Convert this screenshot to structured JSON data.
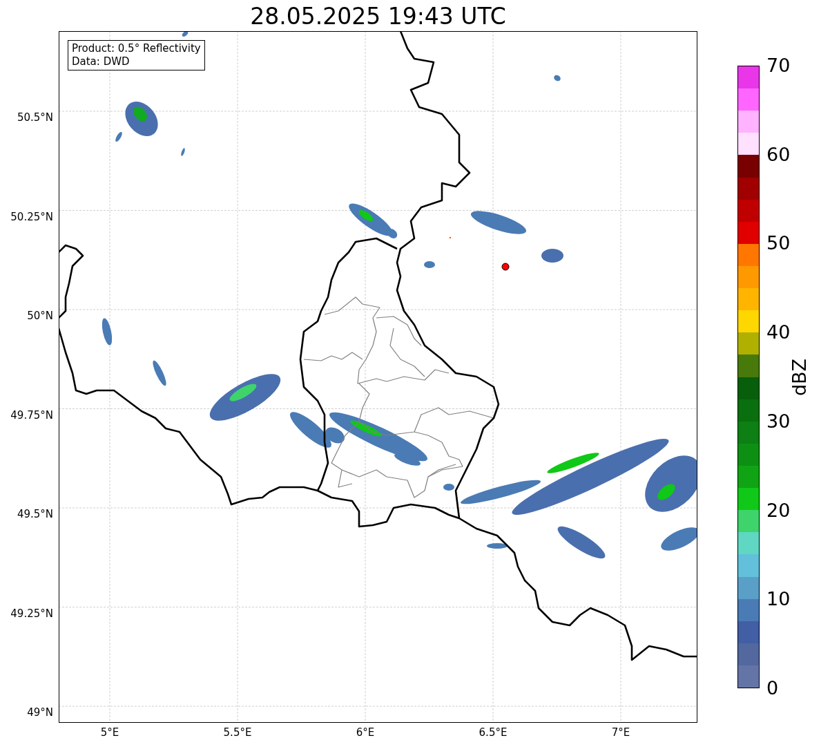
{
  "title": "28.05.2025 19:43 UTC",
  "info_box": {
    "lines": [
      "Product: 0.5° Reflectivity",
      "Data: DWD"
    ]
  },
  "map": {
    "x_ticks": [
      "5°E",
      "5.5°E",
      "6°E",
      "6.5°E",
      "7°E"
    ],
    "y_ticks": [
      "50.5°N",
      "50.25°N",
      "50°N",
      "49.75°N",
      "49.5°N",
      "49.25°N",
      "49°N"
    ]
  },
  "colorbar": {
    "label": "dBZ",
    "ticks": [
      "70",
      "60",
      "50",
      "40",
      "30",
      "20",
      "10",
      "0"
    ],
    "bands": [
      {
        "color": "#e936e9"
      },
      {
        "color": "#ff66ff"
      },
      {
        "color": "#ffb3ff"
      },
      {
        "color": "#ffe0ff"
      },
      {
        "color": "#780000"
      },
      {
        "color": "#a00000"
      },
      {
        "color": "#c00000"
      },
      {
        "color": "#e00000"
      },
      {
        "color": "#ff7700"
      },
      {
        "color": "#ff9900"
      },
      {
        "color": "#ffb400"
      },
      {
        "color": "#ffd700"
      },
      {
        "color": "#b0b000"
      },
      {
        "color": "#477a0a"
      },
      {
        "color": "#075e0b"
      },
      {
        "color": "#0a6f0f"
      },
      {
        "color": "#0d7f14"
      },
      {
        "color": "#0d8f14"
      },
      {
        "color": "#10a414"
      },
      {
        "color": "#10c817"
      },
      {
        "color": "#3ed46b"
      },
      {
        "color": "#5fd7c3"
      },
      {
        "color": "#62c0da"
      },
      {
        "color": "#5a9fc8"
      },
      {
        "color": "#4a7bb4"
      },
      {
        "color": "#425ea4"
      },
      {
        "color": "#52689e"
      },
      {
        "color": "#6474a6"
      }
    ]
  }
}
